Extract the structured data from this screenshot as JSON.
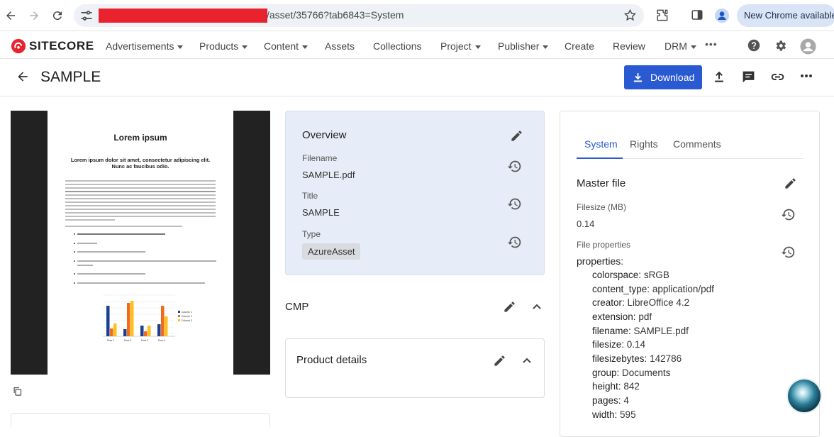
{
  "browser": {
    "url_suffix": "/asset/35766?tab6843=System",
    "new_chrome_label": "New Chrome available"
  },
  "header": {
    "logo_text": "SITECORE",
    "menu": [
      {
        "label": "Advertisements",
        "dropdown": true
      },
      {
        "label": "Products",
        "dropdown": true
      },
      {
        "label": "Content",
        "dropdown": true
      },
      {
        "label": "Assets",
        "dropdown": false
      },
      {
        "label": "Collections",
        "dropdown": false
      },
      {
        "label": "Project",
        "dropdown": true
      },
      {
        "label": "Publisher",
        "dropdown": true
      },
      {
        "label": "Create",
        "dropdown": false
      },
      {
        "label": "Review",
        "dropdown": false
      },
      {
        "label": "DRM",
        "dropdown": true
      }
    ],
    "more_label": "•••"
  },
  "titlebar": {
    "title": "SAMPLE",
    "download_label": "Download"
  },
  "preview": {
    "doc_title": "Lorem ipsum",
    "doc_subtitle": "Lorem ipsum dolor sit amet, consectetur adipiscing elit. Nunc ac faucibus odio.",
    "chart_series": [
      "Column 1",
      "Column 2",
      "Column 3"
    ],
    "chart_categories": [
      "Row 1",
      "Row 2",
      "Row 3",
      "Row 4"
    ]
  },
  "overview": {
    "title": "Overview",
    "fields": [
      {
        "label": "Filename",
        "value": "SAMPLE.pdf"
      },
      {
        "label": "Title",
        "value": "SAMPLE"
      },
      {
        "label": "Type",
        "value": "AzureAsset"
      }
    ]
  },
  "sections": {
    "cmp": "CMP",
    "product_details": "Product details"
  },
  "right_panel": {
    "tabs": [
      "System",
      "Rights",
      "Comments"
    ],
    "active_tab": "System",
    "master_file_title": "Master file",
    "filesize_label": "Filesize (MB)",
    "filesize_value": "0.14",
    "file_properties_label": "File properties",
    "properties_heading": "properties:",
    "properties": [
      {
        "key": "colorspace:",
        "value": "sRGB"
      },
      {
        "key": "content_type:",
        "value": "application/pdf"
      },
      {
        "key": "creator:",
        "value": "LibreOffice 4.2"
      },
      {
        "key": "extension:",
        "value": "pdf"
      },
      {
        "key": "filename:",
        "value": "SAMPLE.pdf"
      },
      {
        "key": "filesize:",
        "value": "0.14"
      },
      {
        "key": "filesizebytes:",
        "value": "142786"
      },
      {
        "key": "group:",
        "value": "Documents"
      },
      {
        "key": "height:",
        "value": "842"
      },
      {
        "key": "pages:",
        "value": "4"
      },
      {
        "key": "width:",
        "value": "595"
      }
    ]
  },
  "colors": {
    "accent": "#2a5ad2",
    "brand_red": "#e8232e",
    "overview_bg": "#e6edf8"
  }
}
